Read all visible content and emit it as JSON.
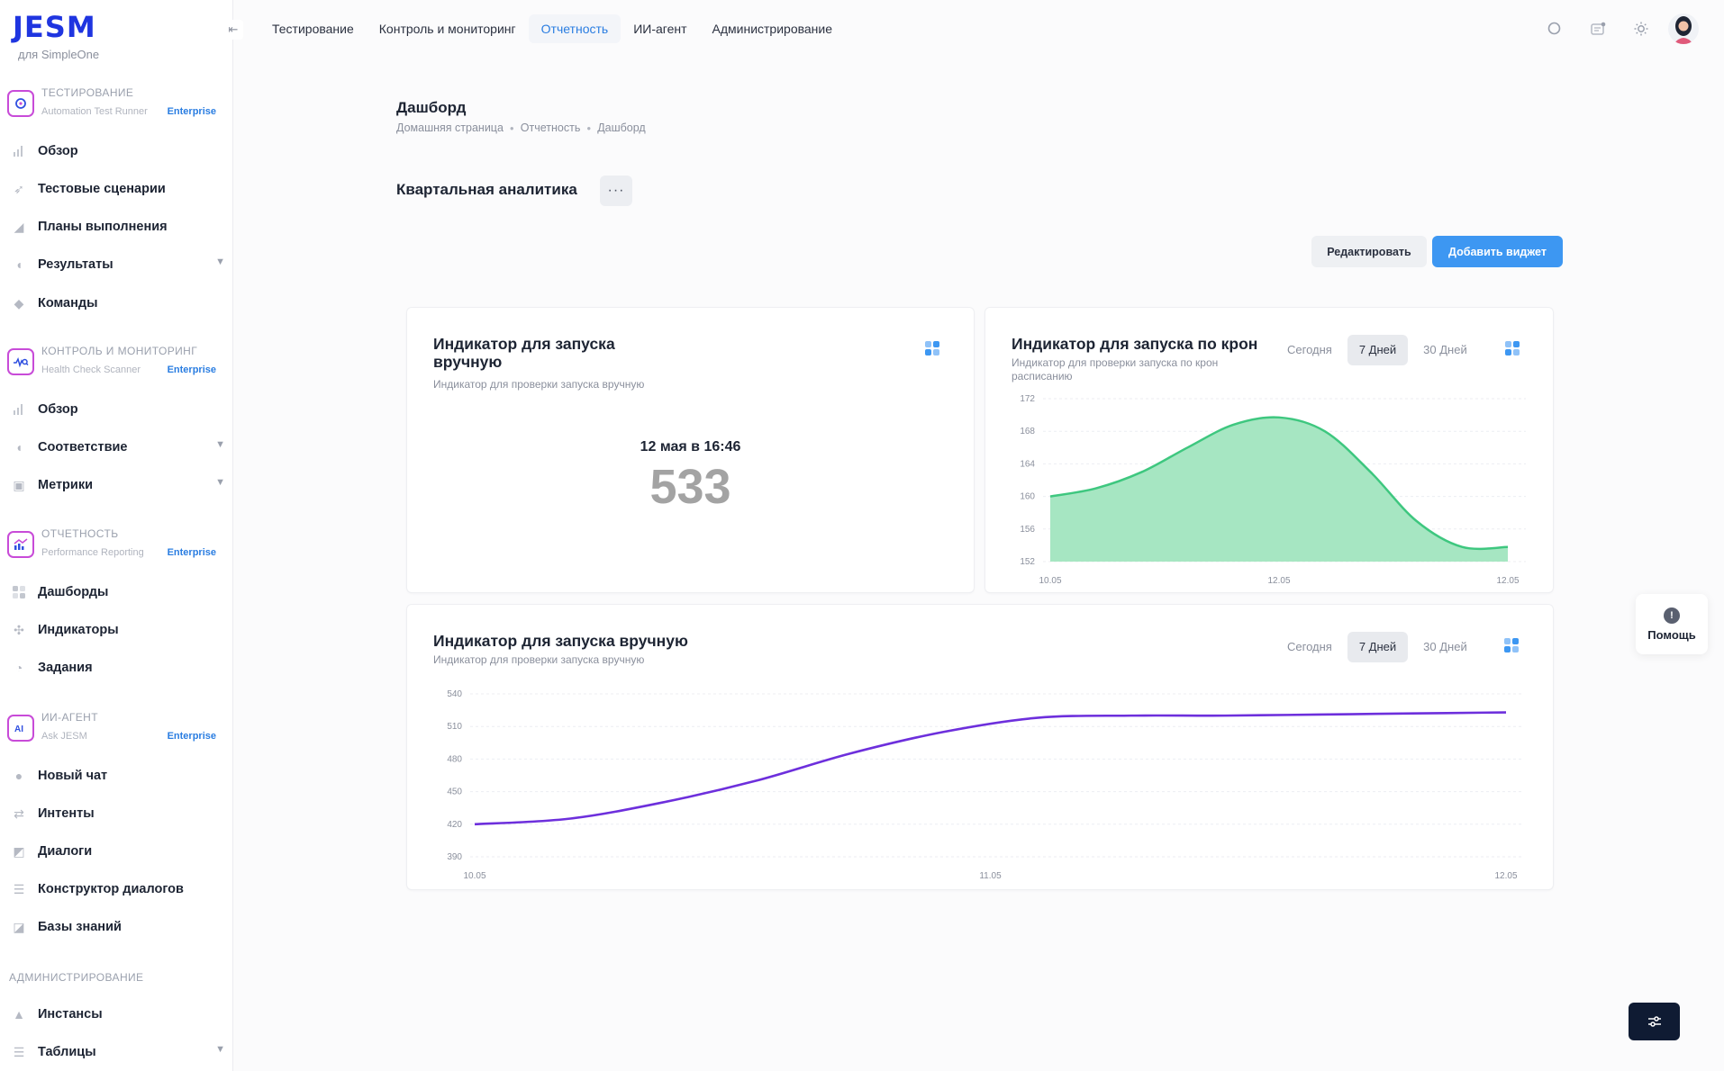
{
  "brand": {
    "logo": "JESM",
    "subtitle": "для SimpleOne"
  },
  "sidebar": {
    "sections": [
      {
        "title": "ТЕСТИРОВАНИЕ",
        "product": "Automation Test Runner",
        "badge": "Enterprise",
        "items": [
          {
            "label": "Обзор"
          },
          {
            "label": "Тестовые сценарии"
          },
          {
            "label": "Планы выполнения"
          },
          {
            "label": "Результаты"
          },
          {
            "label": "Команды"
          }
        ]
      },
      {
        "title": "КОНТРОЛЬ И МОНИТОРИНГ",
        "product": "Health Check Scanner",
        "badge": "Enterprise",
        "items": [
          {
            "label": "Обзор"
          },
          {
            "label": "Соответствие"
          },
          {
            "label": "Метрики"
          }
        ]
      },
      {
        "title": "ОТЧЕТНОСТЬ",
        "product": "Performance Reporting",
        "badge": "Enterprise",
        "items": [
          {
            "label": "Дашборды"
          },
          {
            "label": "Индикаторы"
          },
          {
            "label": "Задания"
          }
        ]
      },
      {
        "title": "ИИ-АГЕНТ",
        "product": "Ask JESM",
        "badge": "Enterprise",
        "items": [
          {
            "label": "Новый чат"
          },
          {
            "label": "Интенты"
          },
          {
            "label": "Диалоги"
          },
          {
            "label": "Конструктор диалогов"
          },
          {
            "label": "Базы знаний"
          }
        ]
      },
      {
        "title": "АДМИНИСТРИРОВАНИЕ",
        "items": [
          {
            "label": "Инстансы"
          },
          {
            "label": "Таблицы"
          }
        ]
      }
    ]
  },
  "topnav": {
    "tabs": [
      {
        "label": "Тестирование"
      },
      {
        "label": "Контроль и мониторинг"
      },
      {
        "label": "Отчетность",
        "active": true
      },
      {
        "label": "ИИ-агент"
      },
      {
        "label": "Администрирование"
      }
    ]
  },
  "page": {
    "title": "Дашборд",
    "breadcrumb": [
      "Домашняя страница",
      "Отчетность",
      "Дашборд"
    ],
    "dashboard_name": "Квартальная аналитика",
    "more_label": "···",
    "edit_label": "Редактировать",
    "add_widget_label": "Добавить виджет"
  },
  "widgets": {
    "kpi": {
      "title": "Индикатор для запуска вручную",
      "subtitle": "Индикатор для проверки запуска вручную",
      "date": "12 мая в 16:46",
      "value": "533"
    },
    "cron": {
      "title": "Индикатор для запуска по крон",
      "subtitle": "Индикатор для проверки запуска по крон расписанию",
      "ranges": [
        "Сегодня",
        "7 Дней",
        "30 Дней"
      ],
      "active_range": "7 Дней"
    },
    "manual_line": {
      "title": "Индикатор для запуска вручную",
      "subtitle": "Индикатор для проверки запуска вручную",
      "ranges": [
        "Сегодня",
        "7 Дней",
        "30 Дней"
      ],
      "active_range": "7 Дней"
    }
  },
  "help": {
    "label": "Помощь"
  },
  "colors": {
    "accent": "#2a7de1",
    "button_primary": "#3d97f2",
    "area_fill": "#a6e6c2",
    "area_line": "#3ec77f",
    "line_series": "#6d2fdc",
    "logo": "#1f35e0"
  },
  "chart_data": [
    {
      "type": "area",
      "x": [
        "10.05",
        "12.05",
        "12.05"
      ],
      "ylim": [
        152,
        172
      ],
      "yticks": [
        152,
        156,
        160,
        164,
        168,
        172
      ],
      "series": [
        {
          "values": [
            160,
            161,
            163,
            166,
            168.8,
            169.7,
            168,
            163,
            157,
            153.8,
            153.8
          ]
        }
      ],
      "grid": true
    },
    {
      "type": "line",
      "x": [
        "10.05",
        "11.05",
        "12.05"
      ],
      "ylim": [
        390,
        540
      ],
      "yticks": [
        390,
        420,
        450,
        480,
        510,
        540
      ],
      "series": [
        {
          "values": [
            420,
            425,
            440,
            460,
            485,
            505,
            518,
            520,
            520,
            521,
            522,
            523
          ]
        }
      ],
      "grid": true
    }
  ]
}
